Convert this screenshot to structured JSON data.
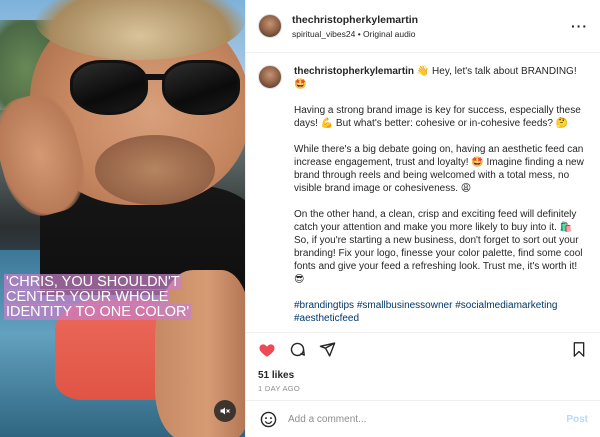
{
  "media": {
    "overlay_text": "'CHRIS, YOU SHOULDN'T CENTER YOUR WHOLE IDENTITY TO ONE COLOR'",
    "mute_icon": "muted-speaker-icon"
  },
  "header": {
    "username": "thechristopherkylemartin",
    "audio_source": "spiritual_vibes24",
    "separator": " • ",
    "audio_label": "Original audio",
    "more_icon": "more-dots-icon"
  },
  "caption": {
    "username": "thechristopherkylemartin",
    "intro": "👋 Hey, let's talk about BRANDING! 🤩",
    "p1": "Having a strong brand image is key for success, especially these days! 💪 But what's better: cohesive or in-cohesive feeds? 🤔",
    "p2": "While there's a big debate going on, having an aesthetic feed can increase engagement, trust and loyalty! 🤩 Imagine finding a new brand through reels and being welcomed with a total mess, no visible brand image or cohesiveness. 😩",
    "p3": "On the other hand, a clean, crisp and exciting feed will definitely catch your attention and make you more likely to buy into it. 🛍️ So, if you're starting a new business, don't forget to sort out your branding! Fix your logo, finesse your color palette, find some cool fonts and give your feed a refreshing look. Trust me, it's worth it! 😎",
    "tags": "#brandingtips #smallbusinessowner #socialmediamarketing #aestheticfeed"
  },
  "actions": {
    "like_icon": "heart-filled-icon",
    "comment_icon": "comment-bubble-icon",
    "share_icon": "paper-plane-icon",
    "save_icon": "bookmark-icon",
    "like_color": "#ed4956"
  },
  "stats": {
    "likes": "51 likes",
    "posted": "1 DAY AGO"
  },
  "comment_box": {
    "emoji_icon": "smiley-icon",
    "placeholder": "Add a comment...",
    "post_label": "Post",
    "post_color": "#b3dbff"
  }
}
